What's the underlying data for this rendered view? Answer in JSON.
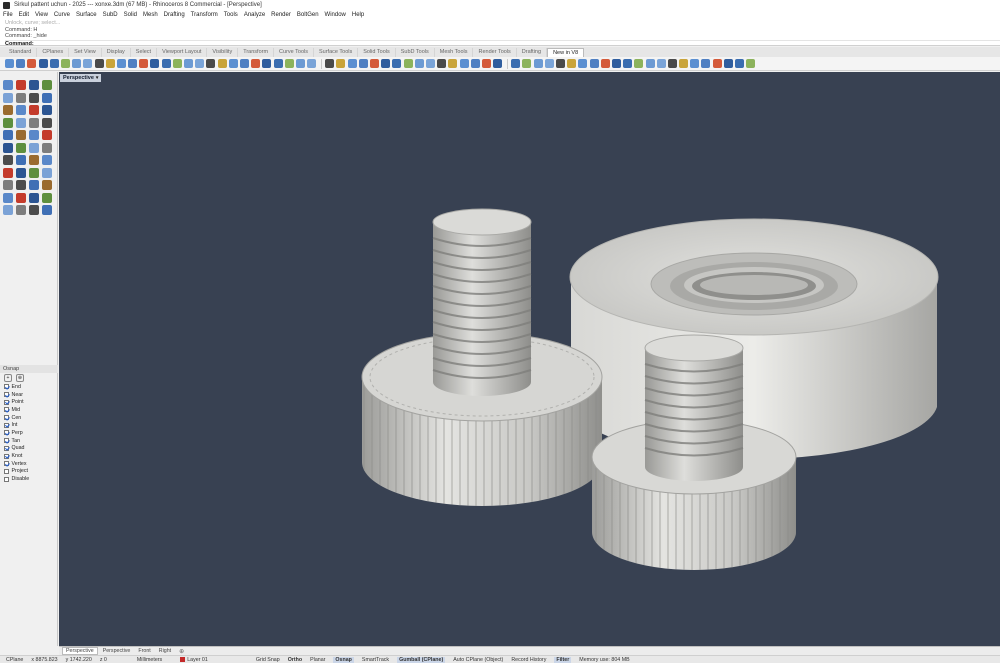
{
  "window": {
    "title": "Sirkul pattent uchun - 2025 --- xonxe.3dm (67 MB) - Rhinoceros 8 Commercial - [Perspective]"
  },
  "menu": [
    "File",
    "Edit",
    "View",
    "Curve",
    "Surface",
    "SubD",
    "Solid",
    "Mesh",
    "Drafting",
    "Transform",
    "Tools",
    "Analyze",
    "Render",
    "BoltGen",
    "Window",
    "Help"
  ],
  "command_history": {
    "faded_line": "Unlock, curve; select...",
    "lines": [
      "Command: H",
      "Command: _hide"
    ],
    "prompt": "Command:"
  },
  "toolbar_tabs": {
    "active_index": 15,
    "items": [
      "Standard",
      "CPlanes",
      "Set View",
      "Display",
      "Select",
      "Viewport Layout",
      "Visibility",
      "Transform",
      "Curve Tools",
      "Surface Tools",
      "Solid Tools",
      "SubD Tools",
      "Mesh Tools",
      "Render Tools",
      "Drafting",
      "New in V8"
    ]
  },
  "osnap": {
    "title": "Osnap",
    "tools": [
      "+",
      "⊕"
    ],
    "items": [
      {
        "label": "End",
        "checked": true
      },
      {
        "label": "Near",
        "checked": true
      },
      {
        "label": "Point",
        "checked": true
      },
      {
        "label": "Mid",
        "checked": true
      },
      {
        "label": "Cen",
        "checked": true
      },
      {
        "label": "Int",
        "checked": true
      },
      {
        "label": "Perp",
        "checked": true
      },
      {
        "label": "Tan",
        "checked": true
      },
      {
        "label": "Quad",
        "checked": true
      },
      {
        "label": "Knot",
        "checked": true
      },
      {
        "label": "Vertex",
        "checked": true
      },
      {
        "label": "Project",
        "checked": false
      },
      {
        "label": "Disable",
        "checked": false
      }
    ]
  },
  "viewport": {
    "label": "Perspective",
    "dropdown_icon": "▾",
    "background_color": "#384152",
    "model_color": "#c8c8c6"
  },
  "view_tabs": {
    "items": [
      "Perspective",
      "Perspective",
      "Front",
      "Right"
    ],
    "active_index": 0,
    "add_symbol": "⊕"
  },
  "status": {
    "cplane": "CPlane",
    "x": "x 8875.823",
    "y": "y 1742.220",
    "z": "z 0",
    "units": "Millimeters",
    "layer": "Layer 01",
    "grid_snap": "Grid Snap",
    "ortho": "Ortho",
    "planar": "Planar",
    "osnap": "Osnap",
    "smarttrack": "SmartTrack",
    "gumball": "Gumball (CPlane)",
    "auto_cplane": "Auto CPlane (Object)",
    "record_history": "Record History",
    "filter": "Filter",
    "memory": "Memory use: 804 MB"
  }
}
